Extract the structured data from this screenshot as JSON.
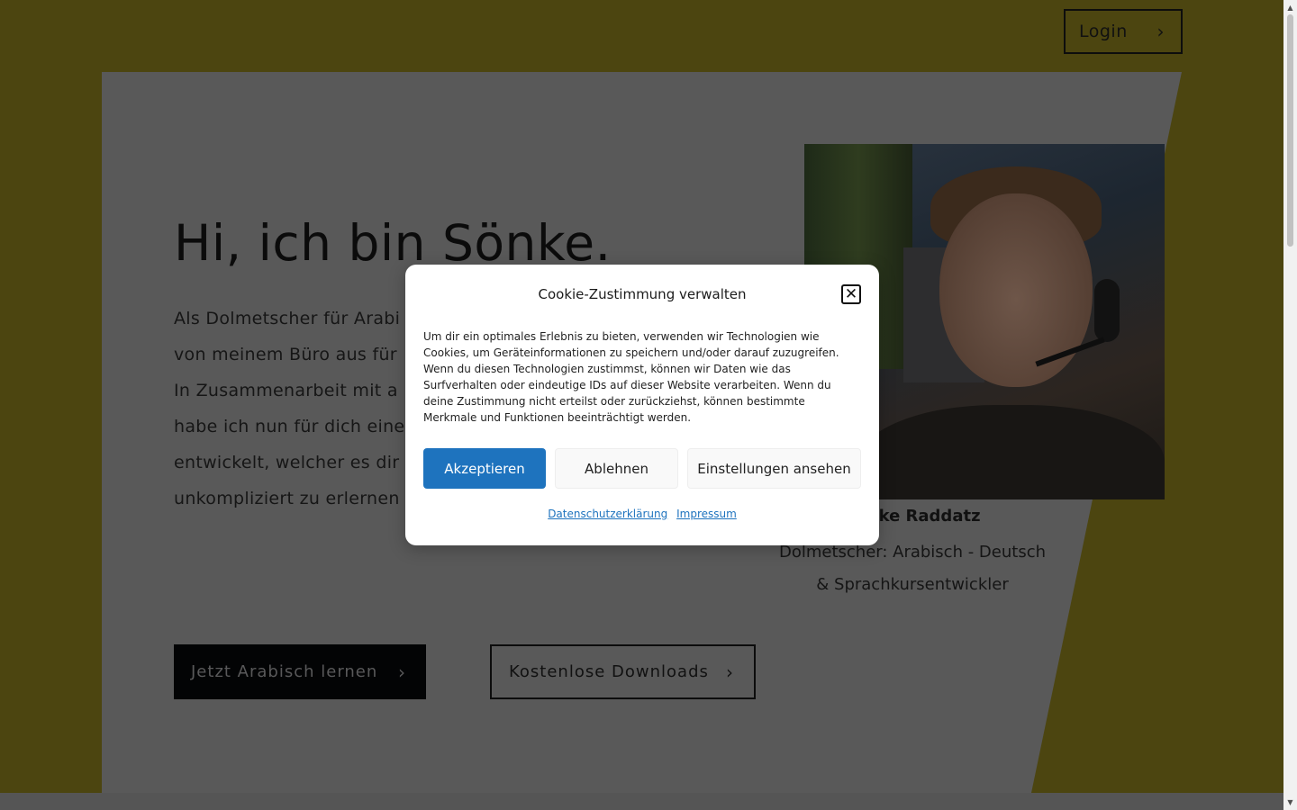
{
  "header": {
    "login_label": "Login",
    "login_chevron": "›"
  },
  "hero": {
    "title": "Hi, ich bin Sönke.",
    "text_lines": [
      "Als Dolmetscher für Arabi",
      "von meinem Büro aus für",
      "In Zusammenarbeit mit a",
      "habe ich nun für dich eine",
      "entwickelt, welcher es dir",
      "unkompliziert zu erlernen"
    ],
    "primary_button": "Jetzt Arabisch lernen",
    "secondary_button": "Kostenlose Downloads",
    "chevron": "›"
  },
  "profile": {
    "photo_icon": "portrait-photo",
    "name": "Sönke Raddatz",
    "role_line1": "Dolmetscher: Arabisch - Deutsch",
    "role_line2": "& Sprachkursentwickler"
  },
  "cookie_modal": {
    "title": "Cookie-Zustimmung verwalten",
    "close_icon": "close-icon",
    "close_glyph": "✕",
    "body": "Um dir ein optimales Erlebnis zu bieten, verwenden wir Technologien wie Cookies, um Geräteinformationen zu speichern und/oder darauf zuzugreifen. Wenn du diesen Technologien zustimmst, können wir Daten wie das Surfverhalten oder eindeutige IDs auf dieser Website verarbeiten. Wenn du deine Zustimmung nicht erteilst oder zurückziehst, können bestimmte Merkmale und Funktionen beeinträchtigt werden.",
    "accept_label": "Akzeptieren",
    "deny_label": "Ablehnen",
    "settings_label": "Einstellungen ansehen",
    "privacy_link": "Datenschutzerklärung",
    "imprint_link": "Impressum"
  },
  "colors": {
    "brand_yellow": "#c8b82a",
    "overlay_dimmed_yellow": "#4c4510",
    "accept_blue": "#1e73be"
  }
}
